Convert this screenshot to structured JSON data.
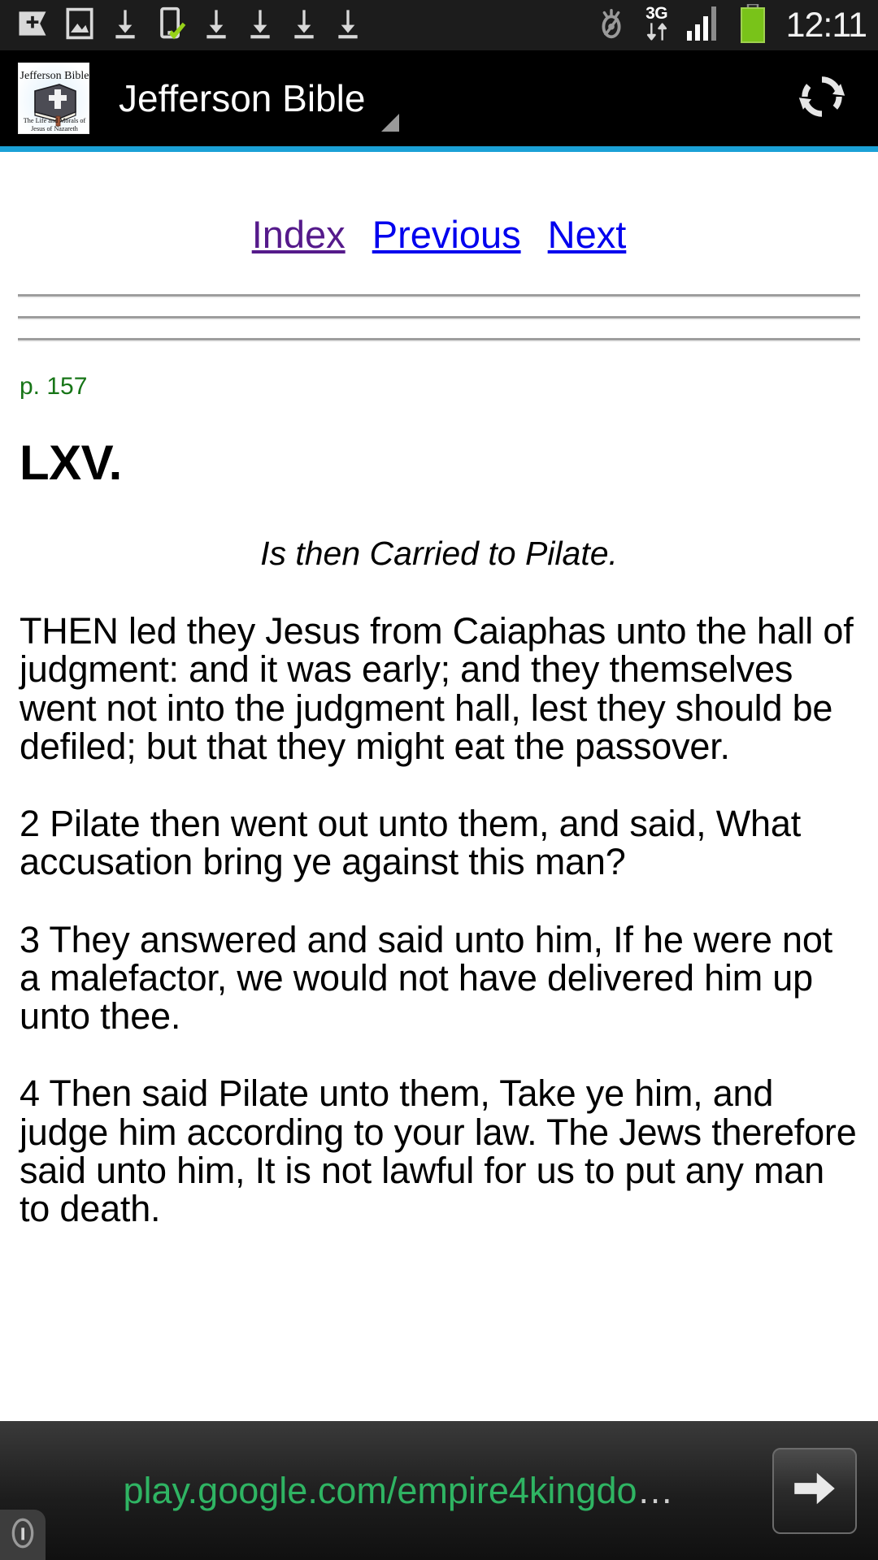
{
  "statusbar": {
    "icons": [
      "add-to-bookmarks-icon",
      "image-icon",
      "download-icon",
      "app-installed-icon",
      "download-icon",
      "download-icon",
      "download-icon",
      "download-icon"
    ],
    "eye_icon": "eye-off-icon",
    "network_label": "3G",
    "data_transfer_icon": "data-transfer-icon",
    "signal_icon": "signal-bars-icon",
    "battery_icon": "battery-full-icon",
    "clock": "12:11"
  },
  "actionbar": {
    "app_icon_name": "jefferson-bible-app-icon",
    "app_icon_text_top": "Jefferson Bible",
    "app_icon_text_line1": "The Life and Morals of",
    "app_icon_text_line2": "Jesus of Nazareth",
    "title": "Jefferson Bible",
    "refresh_label": "refresh-icon",
    "accent_color": "#1ba1d6",
    "background_color": "#000000"
  },
  "nav": {
    "index_label": "Index",
    "previous_label": "Previous",
    "next_label": "Next",
    "visited_color": "#551a8b",
    "link_color": "#0000ee"
  },
  "page": {
    "page_number": "p. 157",
    "page_number_color": "#177517",
    "chapter": "LXV.",
    "subtitle": "Is then Carried to Pilate.",
    "paragraphs": [
      "THEN led they Jesus from Caiaphas unto the hall of judgment: and it was early; and they themselves went not into the judgment hall, lest they should be defiled; but that they might eat the passover.",
      "2 Pilate then went out unto them, and said, What accusation bring ye against this man?",
      "3 They answered and said unto him, If he were not a malefactor, we would not have delivered him up unto thee.",
      "4 Then said Pilate unto them, Take ye him, and judge him according to your law. The Jews therefore said unto him, It is not lawful for us to put any man to death."
    ]
  },
  "ad": {
    "url_text": "play.google.com/empire4kingdo",
    "ellipsis": "…",
    "url_color": "#2fb463",
    "arrow_icon": "arrow-right-icon",
    "info_icon": "info-icon"
  }
}
